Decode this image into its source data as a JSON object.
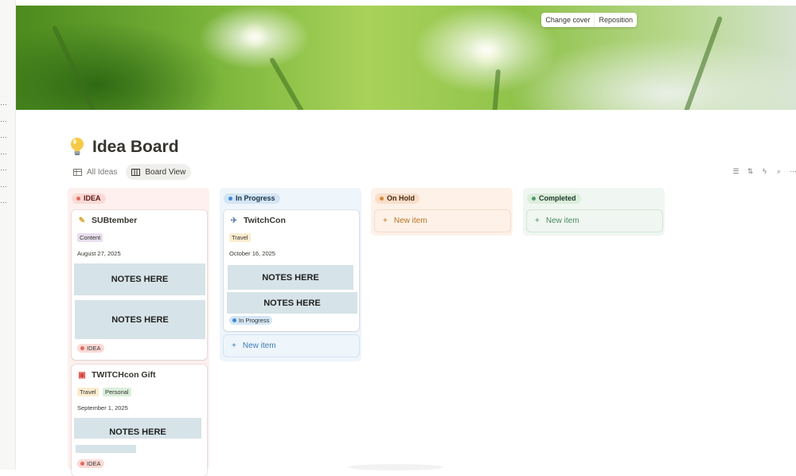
{
  "cover": {
    "change_cover": "Change cover",
    "reposition": "Reposition"
  },
  "page": {
    "icon": "lightbulb-icon",
    "title": "Idea Board"
  },
  "views": [
    {
      "label": "All Ideas",
      "icon": "table-icon",
      "active": false
    },
    {
      "label": "Board View",
      "icon": "board-icon",
      "active": true
    }
  ],
  "toolbar": [
    "filter-icon",
    "sort-icon",
    "automation-icon",
    "search-icon",
    "more-icon"
  ],
  "columns": [
    {
      "name": "IDEA",
      "color": "#e16a5f",
      "pill_bg": "#fbdad6",
      "bg": "#fdf0ee",
      "cards": [
        {
          "icon": "✎",
          "title": "SUBtember",
          "tags": [
            {
              "label": "Content",
              "bg": "#e8deee"
            }
          ],
          "date": "August 27, 2025",
          "notes": [
            "NOTES HERE",
            "NOTES HERE"
          ],
          "status": "IDEA"
        },
        {
          "icon": "🎁",
          "title": "TWITCHcon Gift",
          "tags": [
            {
              "label": "Travel",
              "bg": "#fbecd0"
            },
            {
              "label": "Personal",
              "bg": "#dbeddb"
            }
          ],
          "date": "September 1, 2025",
          "notes": [
            "NOTES HERE"
          ],
          "status": "IDEA"
        }
      ]
    },
    {
      "name": "In Progress",
      "color": "#3e88d6",
      "pill_bg": "#d3e5f5",
      "bg": "#eef5fb",
      "cards": [
        {
          "icon": "✈",
          "title": "TwitchCon",
          "tags": [
            {
              "label": "Travel",
              "bg": "#fbecd0"
            }
          ],
          "date": "October 16, 2025",
          "notes": [
            "NOTES HERE",
            "NOTES HERE"
          ],
          "status": "In Progress"
        }
      ],
      "new_item": "New item"
    },
    {
      "name": "On Hold",
      "color": "#d08a3a",
      "pill_bg": "#fadec9",
      "bg": "#fdf1e8",
      "new_item": "New item"
    },
    {
      "name": "Completed",
      "color": "#4f9a6a",
      "pill_bg": "#dbeddb",
      "bg": "#f0f6f1",
      "new_item": "New item"
    }
  ]
}
